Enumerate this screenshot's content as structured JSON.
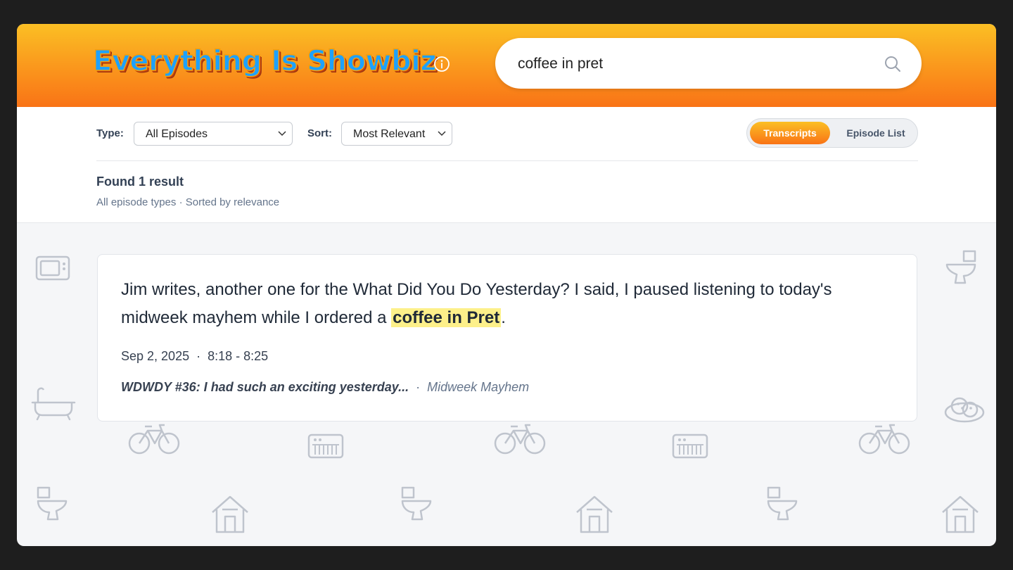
{
  "header": {
    "logo": "Everything Is Showbiz",
    "search_value": "coffee in pret"
  },
  "filters": {
    "type_label": "Type:",
    "type_value": "All Episodes",
    "sort_label": "Sort:",
    "sort_value": "Most Relevant",
    "toggle_active": "Transcripts",
    "toggle_inactive": "Episode List"
  },
  "results": {
    "count_text": "Found 1 result",
    "summary": "All episode types · Sorted by relevance",
    "items": [
      {
        "text_before": "Jim writes, another one for the What Did You Do Yesterday? I said, I paused listening to today's midweek mayhem while I ordered a ",
        "highlight": "coffee in Pret",
        "text_after": ".",
        "date": "Sep 2, 2025",
        "time_range": "8:18 - 8:25",
        "episode_title": "WDWDY #36: I had such an exciting yesterday...",
        "show": "Midweek Mayhem",
        "separator": "·"
      }
    ]
  },
  "colors": {
    "header_top": "#fbbf24",
    "header_bottom": "#f97316",
    "logo_fill": "#1ea1ff",
    "highlight": "#fdf08a"
  },
  "icons": [
    "info-icon",
    "search-icon",
    "chevron-down-icon",
    "microwave-icon",
    "toilet-icon",
    "bathtub-icon",
    "bicycle-icon",
    "keyboard-icon",
    "shed-icon",
    "cookies-icon"
  ]
}
